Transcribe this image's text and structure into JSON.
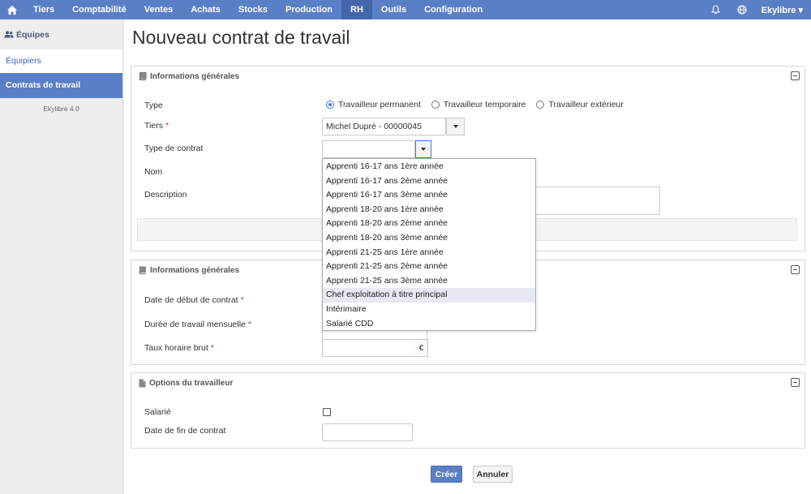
{
  "nav": {
    "items": [
      {
        "label": "Tiers",
        "active": false
      },
      {
        "label": "Comptabilité",
        "active": false
      },
      {
        "label": "Ventes",
        "active": false
      },
      {
        "label": "Achats",
        "active": false
      },
      {
        "label": "Stocks",
        "active": false
      },
      {
        "label": "Production",
        "active": false
      },
      {
        "label": "RH",
        "active": true
      },
      {
        "label": "Outils",
        "active": false
      },
      {
        "label": "Configuration",
        "active": false
      }
    ],
    "user": "Ekylibre ▾"
  },
  "sidebar": {
    "title": "Équipes",
    "items": [
      {
        "label": "Équipiers",
        "active": false
      },
      {
        "label": "Contrats de travail",
        "active": true
      }
    ],
    "version": "Ekylibre 4.0"
  },
  "page": {
    "title": "Nouveau contrat de travail"
  },
  "panel1": {
    "title": "Informations générales",
    "type_label": "Type",
    "type_options": [
      "Travailleur permanent",
      "Travailleur temporaire",
      "Travailleur extérieur"
    ],
    "type_selected": "Travailleur permanent",
    "tiers_label": "Tiers",
    "tiers_value": "Michel Dupré  - 00000045",
    "contract_type_label": "Type de contrat",
    "contract_type_value": "",
    "name_label": "Nom",
    "description_label": "Description",
    "required_mark": "*"
  },
  "dropdown": {
    "options": [
      "Apprenti 16-17 ans 1ère année",
      "Apprenti 16-17 ans 2ème année",
      "Apprenti 16-17 ans 3ème année",
      "Apprenti 18-20 ans 1ère année",
      "Apprenti 18-20 ans 2ème année",
      "Apprenti 18-20 ans 3ème année",
      "Apprenti 21-25 ans 1ère année",
      "Apprenti 21-25 ans 2ème année",
      "Apprenti 21-25 ans 3ème année",
      "Chef exploitation à titre principal",
      "Intérimaire",
      "Salarié CDD"
    ],
    "highlighted": "Chef exploitation à titre principal"
  },
  "panel2": {
    "title": "Informations générales",
    "start_date_label": "Date de début de contrat",
    "monthly_duration_label": "Durée de travail mensuelle",
    "hourly_rate_label": "Taux horaire brut",
    "currency": "€"
  },
  "panel3": {
    "title": "Options du travailleur",
    "salaried_label": "Salarié",
    "salaried_checked": false,
    "end_date_label": "Date de fin de contrat"
  },
  "actions": {
    "create": "Créer",
    "cancel": "Annuler"
  },
  "colors": {
    "nav_bg": "#5b7fc4",
    "nav_active": "#4466aa",
    "link": "#3b68b5",
    "required": "#c0392b"
  },
  "icons": {
    "home": "home-icon",
    "bell": "bell-icon",
    "globe": "globe-icon",
    "team": "team-icon",
    "book": "book-icon",
    "document": "document-icon"
  }
}
